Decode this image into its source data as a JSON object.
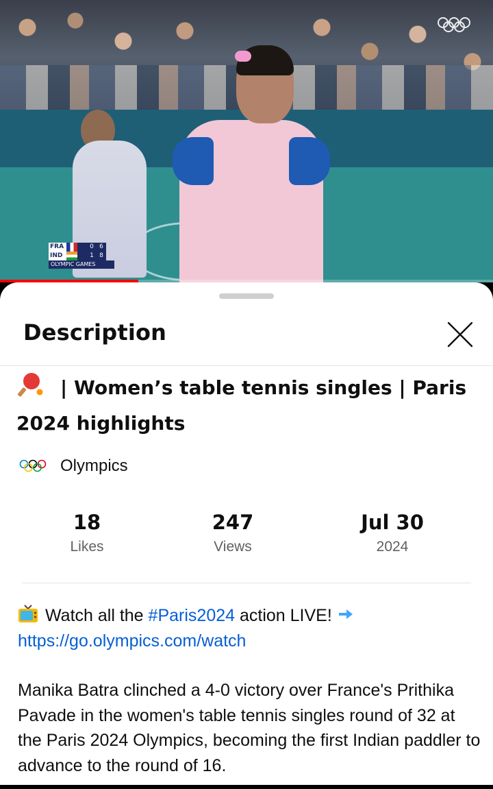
{
  "video": {
    "scoreboard": {
      "rows": [
        {
          "country": "FRA",
          "sets": "0",
          "points": "6"
        },
        {
          "country": "IND",
          "sets": "1",
          "points": "8"
        }
      ],
      "label": "OLYMPIC GAMES"
    },
    "progress_fraction": 0.28
  },
  "sheet": {
    "title": "Description",
    "video_title": "| Women’s table tennis singles | Paris 2024 highlights",
    "title_icon": "ping-pong-paddle-icon",
    "channel": {
      "name": "Olympics",
      "icon": "olympic-rings-icon"
    },
    "stats": [
      {
        "value": "18",
        "label": "Likes"
      },
      {
        "value": "247",
        "label": "Views"
      },
      {
        "value": "Jul 30",
        "label": "2024"
      }
    ],
    "description": {
      "promo_prefix": "Watch all the",
      "hashtag": "#Paris2024",
      "promo_suffix": "action LIVE!",
      "link": "https://go.olympics.com/watch",
      "body": "Manika Batra clinched a 4-0 victory over France's Prithika Pavade in the women's table tennis singles round of 32 at the Paris 2024 Olympics, becoming the first Indian paddler to advance to the round of 16."
    }
  },
  "colors": {
    "link": "#065fd4",
    "progress": "#ff0000",
    "arrow": "#3ea6ff"
  }
}
